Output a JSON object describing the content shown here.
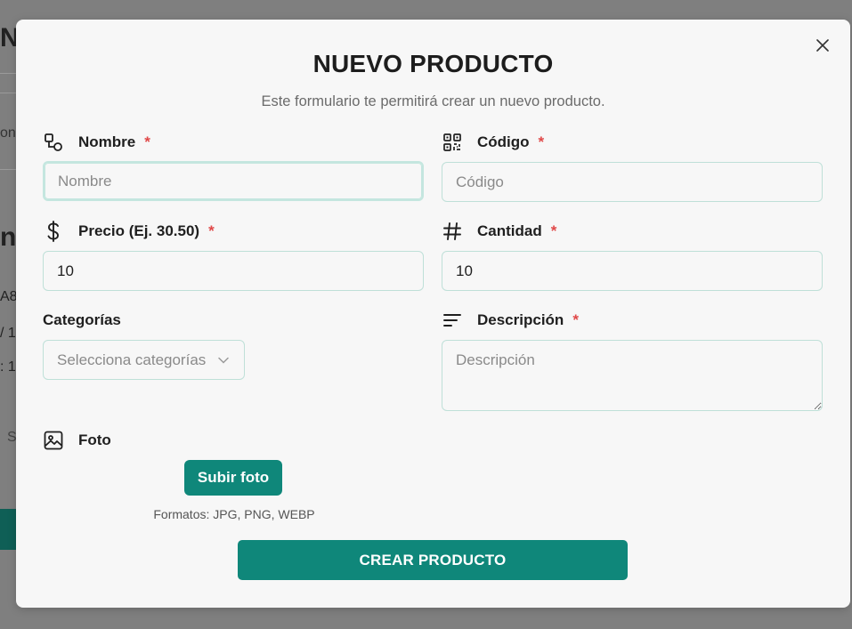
{
  "modal": {
    "title": "NUEVO PRODUCTO",
    "subtitle": "Este formulario te permitirá crear un nuevo producto.",
    "close_icon": "close-icon"
  },
  "fields": {
    "nombre": {
      "label": "Nombre",
      "required_mark": "*",
      "placeholder": "Nombre",
      "value": "",
      "icon": "shapes-icon"
    },
    "codigo": {
      "label": "Código",
      "required_mark": "*",
      "placeholder": "Código",
      "value": "",
      "icon": "qr-code-icon"
    },
    "precio": {
      "label": "Precio (Ej. 30.50)",
      "required_mark": "*",
      "placeholder": "",
      "value": "10",
      "icon": "dollar-icon"
    },
    "cantidad": {
      "label": "Cantidad",
      "required_mark": "*",
      "placeholder": "",
      "value": "10",
      "icon": "hash-icon"
    },
    "categorias": {
      "label": "Categorías",
      "placeholder": "Selecciona categorías"
    },
    "descripcion": {
      "label": "Descripción",
      "required_mark": "*",
      "placeholder": "Descripción",
      "value": "",
      "icon": "text-lines-icon"
    },
    "foto": {
      "label": "Foto",
      "icon": "image-icon",
      "upload_label": "Subir foto",
      "formats": "Formatos: JPG, PNG, WEBP"
    }
  },
  "actions": {
    "create_label": "CREAR PRODUCTO"
  },
  "colors": {
    "accent": "#0f877a",
    "required": "#e04848",
    "input_border": "#bfe0d8",
    "modal_bg": "#f7f7f7"
  },
  "background": {
    "fragments": [
      "N",
      "on",
      "np",
      "A8",
      "/ 1",
      ": 1",
      "S"
    ]
  }
}
